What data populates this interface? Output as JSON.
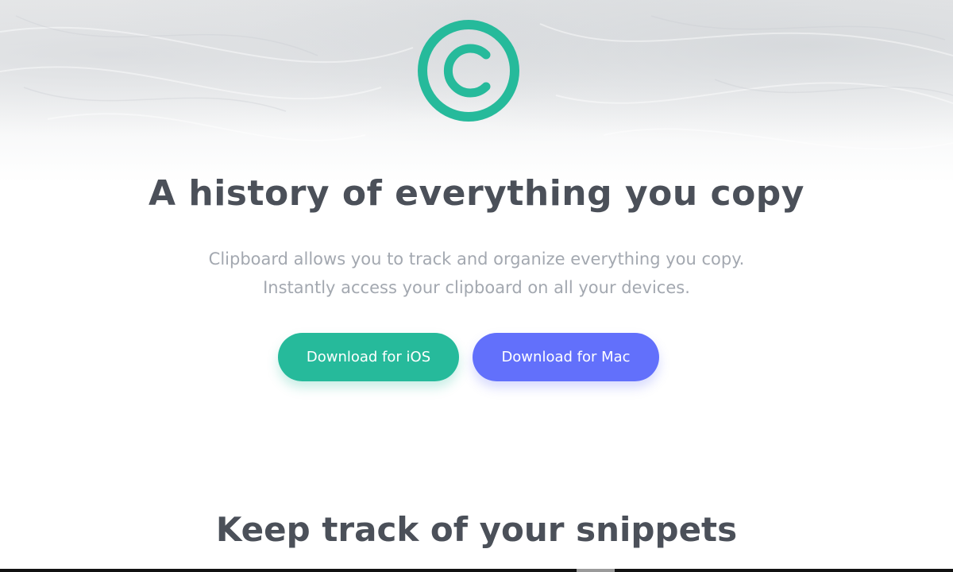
{
  "logo": {
    "icon": "copyright-c-icon",
    "color": "#26ba9b"
  },
  "hero": {
    "title": "A history of everything you copy",
    "subtitle_lines": [
      "Clipboard allows you to track and organize everything you copy.",
      "Instantly access your clipboard on all your devices."
    ]
  },
  "buttons": {
    "ios_label": "Download for iOS",
    "mac_label": "Download for Mac",
    "ios_color": "#26ba9b",
    "mac_color": "#6270fb"
  },
  "snippets_section": {
    "title": "Keep track of your snippets"
  },
  "colors": {
    "heading": "#4b5059",
    "body_text": "#a3a8b0"
  }
}
